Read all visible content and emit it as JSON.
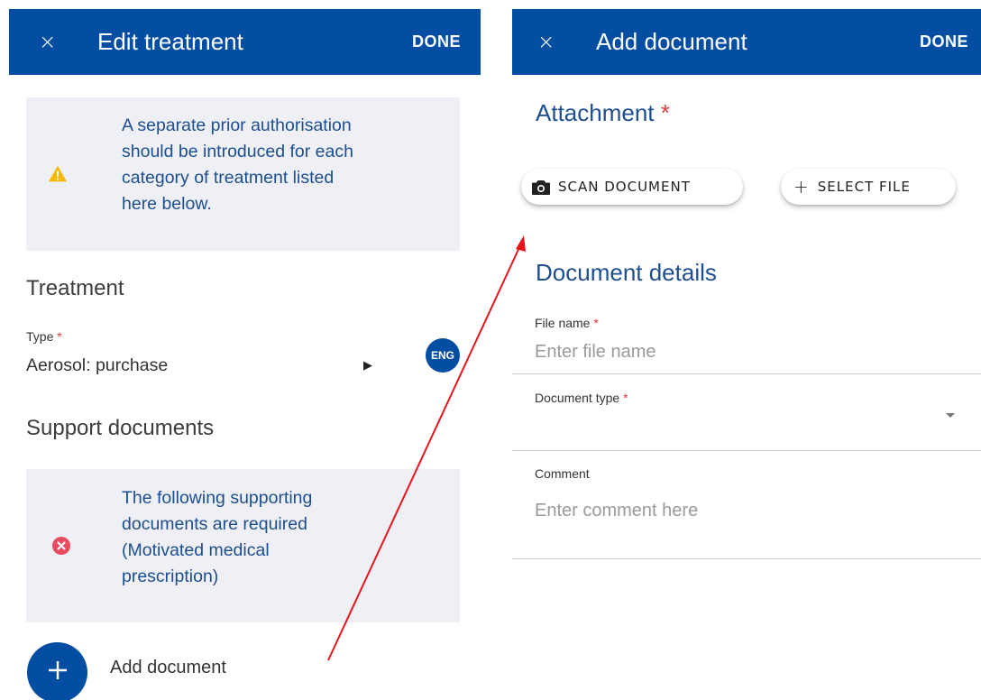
{
  "left_screen": {
    "header": {
      "close_glyph": "×",
      "title": "Edit treatment",
      "done_label": "DONE"
    },
    "warning": {
      "icon": "warning-triangle-icon",
      "lines": [
        "A separate prior authorisation",
        "should be introduced for each",
        "category of treatment listed",
        "here below."
      ]
    },
    "treatment": {
      "heading": "Treatment",
      "type_label": "Type",
      "required_mark": "*",
      "type_value": "Aerosol: purchase",
      "arrow_icon": "play-arrow-icon",
      "language_badge": "ENG"
    },
    "support": {
      "heading": "Support documents",
      "error": {
        "icon": "error-circle-icon",
        "lines": [
          "The following supporting",
          "documents are required",
          "(Motivated medical",
          "prescription)"
        ]
      },
      "add_icon": "plus-icon",
      "add_label": "Add document"
    }
  },
  "right_screen": {
    "header": {
      "close_glyph": "×",
      "title": "Add document",
      "done_label": "DONE"
    },
    "attachment": {
      "heading": "Attachment",
      "required_mark": "*",
      "scan_label": "SCAN DOCUMENT",
      "scan_icon": "camera-icon",
      "select_label": "SELECT FILE",
      "select_icon": "plus-icon"
    },
    "details": {
      "heading": "Document details",
      "file_name_label": "File name",
      "file_name_placeholder": "Enter file name",
      "file_name_value": "",
      "document_type_label": "Document type",
      "document_type_value": "",
      "comment_label": "Comment",
      "comment_placeholder": "Enter comment here",
      "comment_value": "",
      "required_mark": "*"
    }
  },
  "colors": {
    "header_blue": "#034ea2",
    "heading_blue": "#1d4e8f",
    "info_bg": "#eef0f5",
    "required_red": "#e0393e",
    "warning_yellow": "#f5b800",
    "error_red": "#e84a5f",
    "annotation_arrow_red": "#e8141c"
  }
}
